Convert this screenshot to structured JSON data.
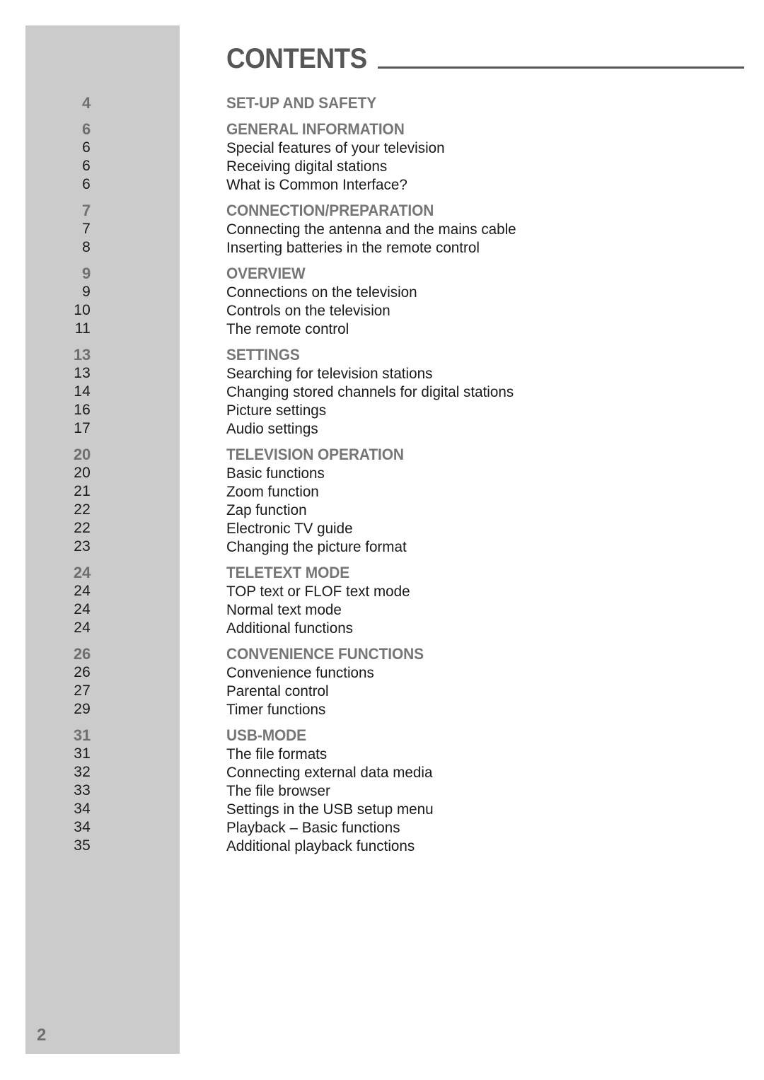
{
  "page": {
    "title": "CONTENTS",
    "folio": "2"
  },
  "toc": {
    "sections": [
      {
        "page": "4",
        "heading": "SET-UP AND SAFETY",
        "entries": []
      },
      {
        "page": "6",
        "heading": "GENERAL INFORMATION",
        "entries": [
          {
            "page": "6",
            "label": "Special features of your television"
          },
          {
            "page": "6",
            "label": "Receiving digital stations"
          },
          {
            "page": "6",
            "label": "What is Common Interface?"
          }
        ]
      },
      {
        "page": "7",
        "heading": "CONNECTION/PREPARATION",
        "entries": [
          {
            "page": "7",
            "label": "Connecting the antenna and the mains cable"
          },
          {
            "page": "8",
            "label": "Inserting batteries in the remote control"
          }
        ]
      },
      {
        "page": "9",
        "heading": "OVERVIEW",
        "entries": [
          {
            "page": "9",
            "label": "Connections on the television"
          },
          {
            "page": "10",
            "label": "Controls on the television"
          },
          {
            "page": "11",
            "label": "The remote control"
          }
        ]
      },
      {
        "page": "13",
        "heading": "SETTINGS",
        "entries": [
          {
            "page": "13",
            "label": "Searching for television stations"
          },
          {
            "page": "14",
            "label": "Changing stored channels for digital stations"
          },
          {
            "page": "16",
            "label": "Picture settings"
          },
          {
            "page": "17",
            "label": "Audio settings"
          }
        ]
      },
      {
        "page": "20",
        "heading": "TELEVISION OPERATION",
        "entries": [
          {
            "page": "20",
            "label": "Basic functions"
          },
          {
            "page": "21",
            "label": "Zoom function"
          },
          {
            "page": "22",
            "label": "Zap function"
          },
          {
            "page": "22",
            "label": "Electronic TV guide"
          },
          {
            "page": "23",
            "label": "Changing the picture format"
          }
        ]
      },
      {
        "page": "24",
        "heading": "TELETEXT MODE",
        "entries": [
          {
            "page": "24",
            "label": "TOP text or FLOF text mode"
          },
          {
            "page": "24",
            "label": "Normal text mode"
          },
          {
            "page": "24",
            "label": "Additional functions"
          }
        ]
      },
      {
        "page": "26",
        "heading": "CONVENIENCE FUNCTIONS",
        "entries": [
          {
            "page": "26",
            "label": "Convenience functions"
          },
          {
            "page": "27",
            "label": "Parental control"
          },
          {
            "page": "29",
            "label": "Timer functions"
          }
        ]
      },
      {
        "page": "31",
        "heading": "USB-MODE",
        "entries": [
          {
            "page": "31",
            "label": "The file formats"
          },
          {
            "page": "32",
            "label": "Connecting external data media"
          },
          {
            "page": "33",
            "label": "The file browser"
          },
          {
            "page": "34",
            "label": "Settings in the USB setup menu"
          },
          {
            "page": "34",
            "label": "Playback – Basic functions"
          },
          {
            "page": "35",
            "label": "Additional playback functions"
          }
        ]
      }
    ]
  }
}
